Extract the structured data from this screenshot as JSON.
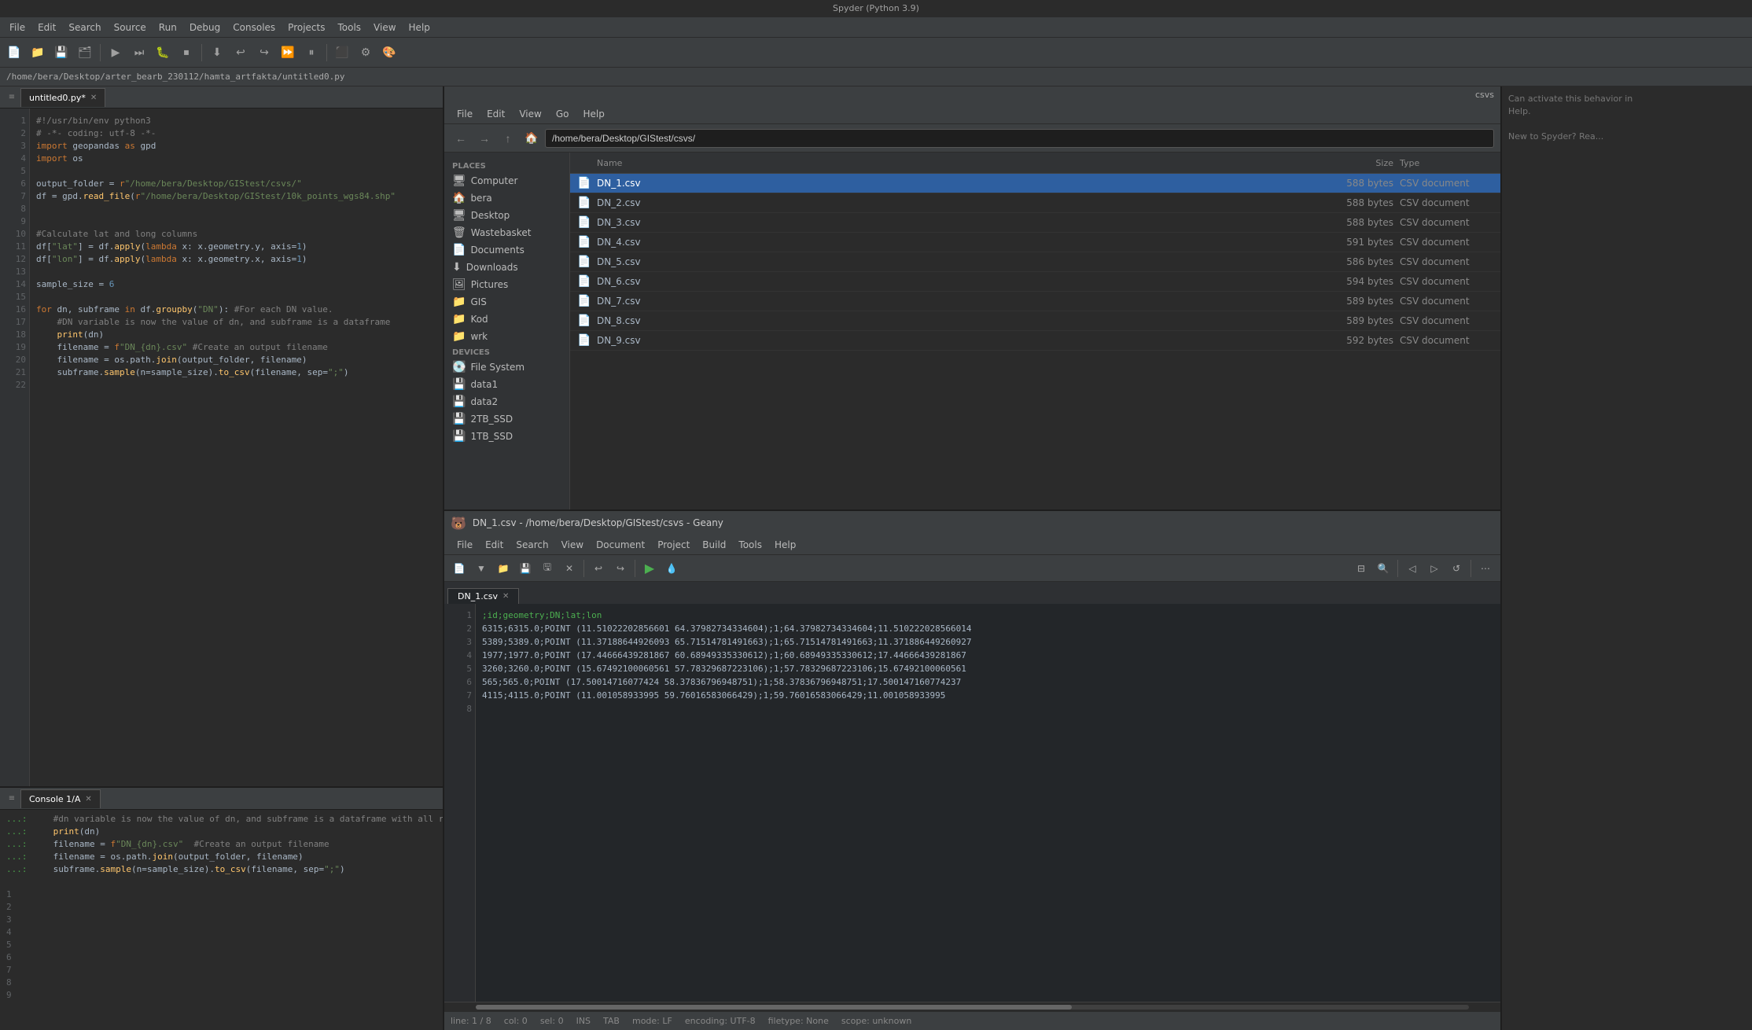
{
  "title_bar": {
    "text": "Spyder (Python 3.9)"
  },
  "menu_bar": {
    "items": [
      "File",
      "Edit",
      "Search",
      "Source",
      "Run",
      "Debug",
      "Consoles",
      "Projects",
      "Tools",
      "View",
      "Help"
    ]
  },
  "path_bar": {
    "path": "/home/bera/Desktop/arter_bearb_230112/hamta_artfakta/untitled0.py"
  },
  "editor": {
    "tab_label": "untitled0.py*",
    "lines": [
      "#!/usr/bin/env python3",
      "# -*- coding: utf-8 -*-",
      "import geopandas as gpd",
      "import os",
      "",
      "output_folder = r\"/home/bera/Desktop/GIStest/csvs/\"",
      "df = gpd.read_file(r\"/home/bera/Desktop/GIStest/10k_points_wgs84.shp\"",
      "",
      "",
      "#Calculate lat and long columns",
      "df[\"lat\"] = df.apply(lambda x: x.geometry.y, axis=1)",
      "df[\"lon\"] = df.apply(lambda x: x.geometry.x, axis=1)",
      "",
      "sample_size = 6",
      "",
      "for dn, subframe in df.groupby(\"DN\"): #For each DN value.",
      "    #DN variable is now the value of dn, and subframe is a dataframe",
      "    print(dn)",
      "    filename = f\"DN_{dn}.csv\" #Create an output filename",
      "    filename = os.path.join(output_folder, filename)",
      "    subframe.sample(n=sample_size).to_csv(filename, sep=\";\")",
      ""
    ]
  },
  "console": {
    "tab_label": "Console 1/A",
    "lines": [
      "    #dn variable is now the value of dn, and subframe is a dataframe with all rows with that dn value",
      "    print(dn)",
      "    filename = f\"DN_{dn}.csv\"  #Create an output filename",
      "    filename = os.path.join(output_folder, filename)",
      "    subframe.sample(n=sample_size).to_csv(filename, sep=\";\")"
    ],
    "prompts": [
      "...: ",
      "...: ",
      "...: ",
      "...: ",
      "...: "
    ]
  },
  "file_manager": {
    "title": "csvs",
    "current_path": "/home/bera/Desktop/GIStest/csvs/",
    "places": {
      "section": "Places",
      "items": [
        "Computer",
        "bera",
        "Desktop",
        "Wastebasket",
        "Documents",
        "Downloads",
        "Pictures",
        "GIS",
        "Kod",
        "wrk"
      ]
    },
    "devices": {
      "section": "Devices",
      "items": [
        "File System",
        "data1",
        "data2",
        "2TB_SSD",
        "1TB_SSD"
      ]
    },
    "columns": {
      "name": "Name",
      "size": "Size",
      "type": "Type"
    },
    "files": [
      {
        "name": "DN_1.csv",
        "size": "588 bytes",
        "type": "CSV document",
        "selected": true
      },
      {
        "name": "DN_2.csv",
        "size": "588 bytes",
        "type": "CSV document",
        "selected": false
      },
      {
        "name": "DN_3.csv",
        "size": "588 bytes",
        "type": "CSV document",
        "selected": false
      },
      {
        "name": "DN_4.csv",
        "size": "591 bytes",
        "type": "CSV document",
        "selected": false
      },
      {
        "name": "DN_5.csv",
        "size": "586 bytes",
        "type": "CSV document",
        "selected": false
      },
      {
        "name": "DN_6.csv",
        "size": "594 bytes",
        "type": "CSV document",
        "selected": false
      },
      {
        "name": "DN_7.csv",
        "size": "589 bytes",
        "type": "CSV document",
        "selected": false
      },
      {
        "name": "DN_8.csv",
        "size": "589 bytes",
        "type": "CSV document",
        "selected": false
      },
      {
        "name": "DN_9.csv",
        "size": "592 bytes",
        "type": "CSV document",
        "selected": false
      }
    ]
  },
  "geany": {
    "title": "DN_1.csv - /home/bera/Desktop/GIStest/csvs - Geany",
    "tab_label": "DN_1.csv",
    "menu_items": [
      "File",
      "Edit",
      "Search",
      "View",
      "Document",
      "Project",
      "Build",
      "Tools",
      "Help"
    ],
    "lines": [
      ";id;geometry;DN;lat;lon",
      "6315;6315.0;POINT (11.51022202856601 64.37982734334604);1;64.37982734334604;11.510222028566014",
      "5389;5389.0;POINT (11.37188644926093 65.71514781491663);1;65.71514781491663;11.371886449260927",
      "1977;1977.0;POINT (17.44666439281867 60.68949335330612);1;60.68949335330612;17.44666439281867",
      "3260;3260.0;POINT (15.6749210006056l 57.78329687223106);1;57.78329687223106;15.6749210006056l",
      "565;565.0;POINT (17.50014716077424 58.37836796948751);1;58.37836796948751;17.500147160774237",
      "4115;4115.0;POINT (11.001058933995 59.76016583066429);1;59.76016583066429;11.001058933995",
      ""
    ],
    "status_bar": {
      "line": "line: 1 / 8",
      "col": "col: 0",
      "sel": "sel: 0",
      "ins": "INS",
      "tab": "TAB",
      "mode": "mode: LF",
      "encoding": "encoding: UTF-8",
      "filetype": "filetype: None",
      "scope": "scope: unknown"
    }
  },
  "right_panel": {
    "text": "Can activate this behavior in\nHelp.\n\nNew to Spyder? Rea..."
  }
}
